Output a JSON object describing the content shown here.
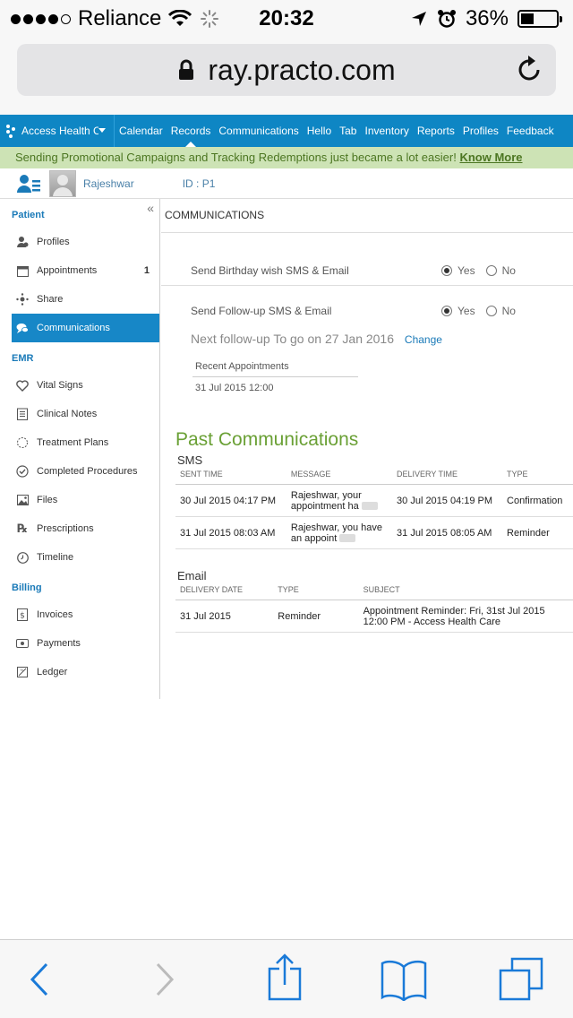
{
  "status": {
    "carrier": "Reliance",
    "time": "20:32",
    "battery": "36%",
    "battery_level": 0.36
  },
  "browser": {
    "url": "ray.practo.com"
  },
  "topnav": {
    "clinic": "Access Health Care",
    "items": [
      "Calendar",
      "Records",
      "Communications",
      "Hello",
      "Tab",
      "Inventory",
      "Reports",
      "Profiles",
      "Feedback"
    ],
    "active": "Records"
  },
  "promo": {
    "text": "Sending Promotional Campaigns and Tracking Redemptions just became a lot easier!",
    "link": "Know More"
  },
  "patient": {
    "name": "Rajeshwar",
    "id": "ID : P1"
  },
  "sidebar": {
    "patient_title": "Patient",
    "patient_items": [
      {
        "label": "Profiles",
        "icon": "profile-icon"
      },
      {
        "label": "Appointments",
        "icon": "calendar-icon",
        "count": "1"
      },
      {
        "label": "Share",
        "icon": "share-icon"
      },
      {
        "label": "Communications",
        "icon": "chat-icon"
      }
    ],
    "emr_title": "EMR",
    "emr_items": [
      {
        "label": "Vital Signs",
        "icon": "heart-icon"
      },
      {
        "label": "Clinical Notes",
        "icon": "notes-icon"
      },
      {
        "label": "Treatment Plans",
        "icon": "plan-icon"
      },
      {
        "label": "Completed Procedures",
        "icon": "check-circle-icon"
      },
      {
        "label": "Files",
        "icon": "image-icon"
      },
      {
        "label": "Prescriptions",
        "icon": "rx-icon"
      },
      {
        "label": "Timeline",
        "icon": "clock-icon"
      }
    ],
    "billing_title": "Billing",
    "billing_items": [
      {
        "label": "Invoices",
        "icon": "invoice-icon"
      },
      {
        "label": "Payments",
        "icon": "payment-icon"
      },
      {
        "label": "Ledger",
        "icon": "ledger-icon"
      }
    ]
  },
  "main": {
    "title": "COMMUNICATIONS",
    "birthday_label": "Send Birthday wish SMS & Email",
    "followup_label": "Send Follow-up SMS & Email",
    "yes": "Yes",
    "no": "No",
    "next_followup": "Next follow-up To go on 27 Jan 2016",
    "change": "Change",
    "recent_header": "Recent Appointments",
    "recent_value": "31 Jul 2015 12:00",
    "past_title": "Past Communications",
    "sms_title": "SMS",
    "sms_headers": [
      "SENT TIME",
      "MESSAGE",
      "DELIVERY TIME",
      "TYPE"
    ],
    "sms_rows": [
      {
        "sent": "30 Jul 2015 04:17 PM",
        "message": "Rajeshwar, your appointment ha",
        "delivery": "30 Jul 2015 04:19 PM",
        "type": "Confirmation"
      },
      {
        "sent": "31 Jul 2015 08:03 AM",
        "message": "Rajeshwar, you have an appoint",
        "delivery": "31 Jul 2015 08:05 AM",
        "type": "Reminder"
      }
    ],
    "email_title": "Email",
    "email_headers": [
      "DELIVERY DATE",
      "TYPE",
      "SUBJECT"
    ],
    "email_rows": [
      {
        "date": "31 Jul 2015",
        "type": "Reminder",
        "subject": "Appointment Reminder: Fri, 31st Jul 2015 12:00 PM - Access Health Care"
      }
    ]
  }
}
